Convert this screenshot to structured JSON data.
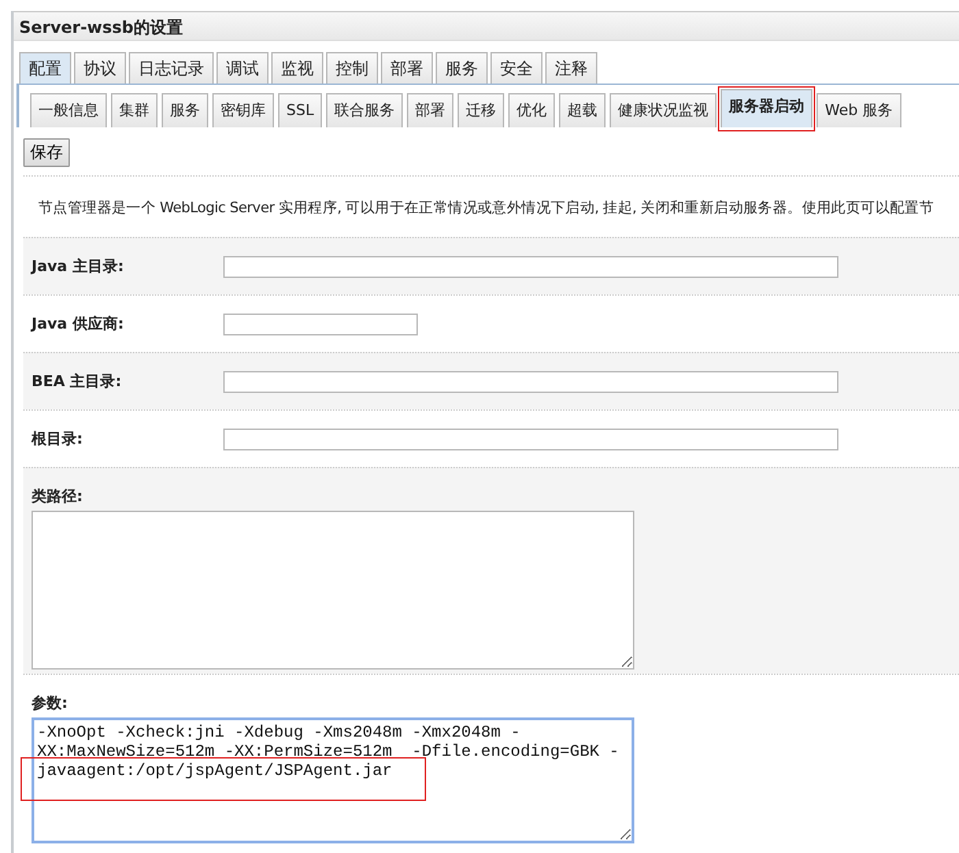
{
  "window": {
    "title": "Server-wssb的设置"
  },
  "tabs": [
    {
      "label": "配置",
      "selected": true
    },
    {
      "label": "协议",
      "selected": false
    },
    {
      "label": "日志记录",
      "selected": false
    },
    {
      "label": "调试",
      "selected": false
    },
    {
      "label": "监视",
      "selected": false
    },
    {
      "label": "控制",
      "selected": false
    },
    {
      "label": "部署",
      "selected": false
    },
    {
      "label": "服务",
      "selected": false
    },
    {
      "label": "安全",
      "selected": false
    },
    {
      "label": "注释",
      "selected": false
    }
  ],
  "subtabs": [
    {
      "label": "一般信息",
      "selected": false,
      "highlighted": false
    },
    {
      "label": "集群",
      "selected": false,
      "highlighted": false
    },
    {
      "label": "服务",
      "selected": false,
      "highlighted": false
    },
    {
      "label": "密钥库",
      "selected": false,
      "highlighted": false
    },
    {
      "label": "SSL",
      "selected": false,
      "highlighted": false
    },
    {
      "label": "联合服务",
      "selected": false,
      "highlighted": false
    },
    {
      "label": "部署",
      "selected": false,
      "highlighted": false
    },
    {
      "label": "迁移",
      "selected": false,
      "highlighted": false
    },
    {
      "label": "优化",
      "selected": false,
      "highlighted": false
    },
    {
      "label": "超载",
      "selected": false,
      "highlighted": false
    },
    {
      "label": "健康状况监视",
      "selected": false,
      "highlighted": false
    },
    {
      "label": "服务器启动",
      "selected": true,
      "highlighted": true
    },
    {
      "label": "Web 服务",
      "selected": false,
      "highlighted": false
    }
  ],
  "save_button": "保存",
  "description": "节点管理器是一个 WebLogic Server 实用程序, 可以用于在正常情况或意外情况下启动, 挂起, 关闭和重新启动服务器。使用此页可以配置节",
  "form": [
    {
      "kind": "text",
      "label": "Java 主目录:"
    },
    {
      "kind": "short_text",
      "label": "Java 供应商:"
    },
    {
      "kind": "text",
      "label": "BEA 主目录:"
    },
    {
      "kind": "text",
      "label": "根目录:"
    },
    {
      "kind": "textarea",
      "label": "类路径:",
      "focused": false
    },
    {
      "kind": "textarea",
      "label": "参数:",
      "value": "-XnoOpt -Xcheck:jni -Xdebug -Xms2048m -Xmx2048m -XX:MaxNewSize=512m -XX:PermSize=512m  -Dfile.encoding=GBK -javaagent:/opt/jspAgent/JSPAgent.jar",
      "focused": true,
      "highlighted": true
    }
  ]
}
